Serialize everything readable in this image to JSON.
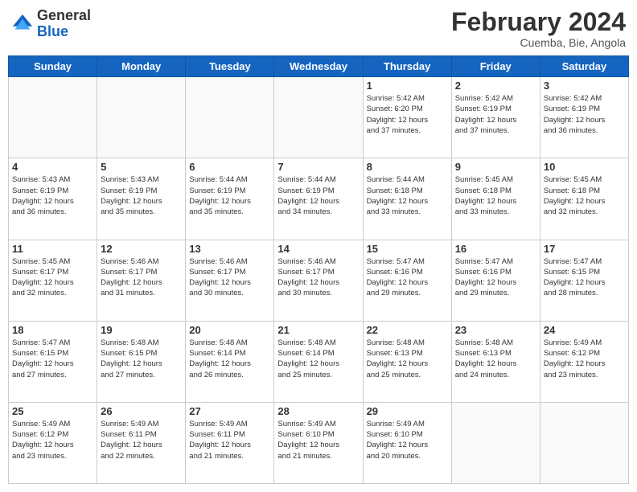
{
  "header": {
    "logo_general": "General",
    "logo_blue": "Blue",
    "month_year": "February 2024",
    "location": "Cuemba, Bie, Angola"
  },
  "days_of_week": [
    "Sunday",
    "Monday",
    "Tuesday",
    "Wednesday",
    "Thursday",
    "Friday",
    "Saturday"
  ],
  "weeks": [
    [
      {
        "day": "",
        "info": ""
      },
      {
        "day": "",
        "info": ""
      },
      {
        "day": "",
        "info": ""
      },
      {
        "day": "",
        "info": ""
      },
      {
        "day": "1",
        "info": "Sunrise: 5:42 AM\nSunset: 6:20 PM\nDaylight: 12 hours\nand 37 minutes."
      },
      {
        "day": "2",
        "info": "Sunrise: 5:42 AM\nSunset: 6:19 PM\nDaylight: 12 hours\nand 37 minutes."
      },
      {
        "day": "3",
        "info": "Sunrise: 5:42 AM\nSunset: 6:19 PM\nDaylight: 12 hours\nand 36 minutes."
      }
    ],
    [
      {
        "day": "4",
        "info": "Sunrise: 5:43 AM\nSunset: 6:19 PM\nDaylight: 12 hours\nand 36 minutes."
      },
      {
        "day": "5",
        "info": "Sunrise: 5:43 AM\nSunset: 6:19 PM\nDaylight: 12 hours\nand 35 minutes."
      },
      {
        "day": "6",
        "info": "Sunrise: 5:44 AM\nSunset: 6:19 PM\nDaylight: 12 hours\nand 35 minutes."
      },
      {
        "day": "7",
        "info": "Sunrise: 5:44 AM\nSunset: 6:19 PM\nDaylight: 12 hours\nand 34 minutes."
      },
      {
        "day": "8",
        "info": "Sunrise: 5:44 AM\nSunset: 6:18 PM\nDaylight: 12 hours\nand 33 minutes."
      },
      {
        "day": "9",
        "info": "Sunrise: 5:45 AM\nSunset: 6:18 PM\nDaylight: 12 hours\nand 33 minutes."
      },
      {
        "day": "10",
        "info": "Sunrise: 5:45 AM\nSunset: 6:18 PM\nDaylight: 12 hours\nand 32 minutes."
      }
    ],
    [
      {
        "day": "11",
        "info": "Sunrise: 5:45 AM\nSunset: 6:17 PM\nDaylight: 12 hours\nand 32 minutes."
      },
      {
        "day": "12",
        "info": "Sunrise: 5:46 AM\nSunset: 6:17 PM\nDaylight: 12 hours\nand 31 minutes."
      },
      {
        "day": "13",
        "info": "Sunrise: 5:46 AM\nSunset: 6:17 PM\nDaylight: 12 hours\nand 30 minutes."
      },
      {
        "day": "14",
        "info": "Sunrise: 5:46 AM\nSunset: 6:17 PM\nDaylight: 12 hours\nand 30 minutes."
      },
      {
        "day": "15",
        "info": "Sunrise: 5:47 AM\nSunset: 6:16 PM\nDaylight: 12 hours\nand 29 minutes."
      },
      {
        "day": "16",
        "info": "Sunrise: 5:47 AM\nSunset: 6:16 PM\nDaylight: 12 hours\nand 29 minutes."
      },
      {
        "day": "17",
        "info": "Sunrise: 5:47 AM\nSunset: 6:15 PM\nDaylight: 12 hours\nand 28 minutes."
      }
    ],
    [
      {
        "day": "18",
        "info": "Sunrise: 5:47 AM\nSunset: 6:15 PM\nDaylight: 12 hours\nand 27 minutes."
      },
      {
        "day": "19",
        "info": "Sunrise: 5:48 AM\nSunset: 6:15 PM\nDaylight: 12 hours\nand 27 minutes."
      },
      {
        "day": "20",
        "info": "Sunrise: 5:48 AM\nSunset: 6:14 PM\nDaylight: 12 hours\nand 26 minutes."
      },
      {
        "day": "21",
        "info": "Sunrise: 5:48 AM\nSunset: 6:14 PM\nDaylight: 12 hours\nand 25 minutes."
      },
      {
        "day": "22",
        "info": "Sunrise: 5:48 AM\nSunset: 6:13 PM\nDaylight: 12 hours\nand 25 minutes."
      },
      {
        "day": "23",
        "info": "Sunrise: 5:48 AM\nSunset: 6:13 PM\nDaylight: 12 hours\nand 24 minutes."
      },
      {
        "day": "24",
        "info": "Sunrise: 5:49 AM\nSunset: 6:12 PM\nDaylight: 12 hours\nand 23 minutes."
      }
    ],
    [
      {
        "day": "25",
        "info": "Sunrise: 5:49 AM\nSunset: 6:12 PM\nDaylight: 12 hours\nand 23 minutes."
      },
      {
        "day": "26",
        "info": "Sunrise: 5:49 AM\nSunset: 6:11 PM\nDaylight: 12 hours\nand 22 minutes."
      },
      {
        "day": "27",
        "info": "Sunrise: 5:49 AM\nSunset: 6:11 PM\nDaylight: 12 hours\nand 21 minutes."
      },
      {
        "day": "28",
        "info": "Sunrise: 5:49 AM\nSunset: 6:10 PM\nDaylight: 12 hours\nand 21 minutes."
      },
      {
        "day": "29",
        "info": "Sunrise: 5:49 AM\nSunset: 6:10 PM\nDaylight: 12 hours\nand 20 minutes."
      },
      {
        "day": "",
        "info": ""
      },
      {
        "day": "",
        "info": ""
      }
    ]
  ]
}
